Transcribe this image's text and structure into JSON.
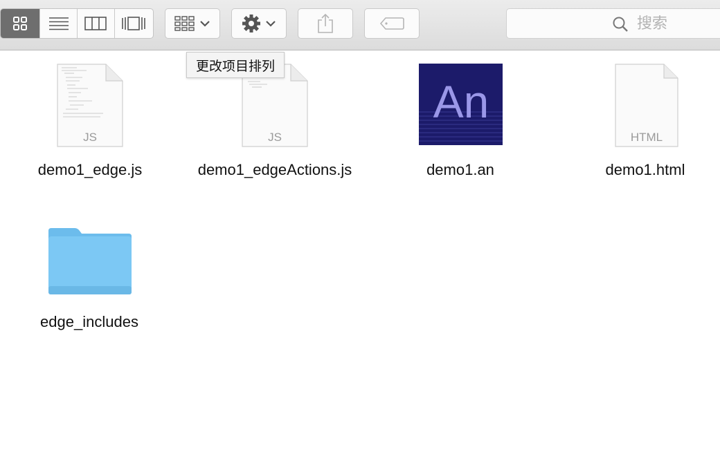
{
  "toolbar": {
    "view_modes": [
      {
        "id": "icon-view",
        "label": "Icons",
        "active": true
      },
      {
        "id": "list-view",
        "label": "List",
        "active": false
      },
      {
        "id": "column-view",
        "label": "Columns",
        "active": false
      },
      {
        "id": "coverflow-view",
        "label": "Cover Flow",
        "active": false
      }
    ],
    "arrange_icon": "arrange-grid-icon",
    "action_icon": "gear-icon",
    "share_icon": "share-icon",
    "tag_icon": "tag-icon",
    "search": {
      "placeholder": "搜索"
    }
  },
  "tooltip": {
    "text": "更改项目排列"
  },
  "files": [
    {
      "name": "demo1_edge.js",
      "type": "JS",
      "icon": "js-document-icon"
    },
    {
      "name": "demo1_edgeActions.js",
      "type": "JS",
      "icon": "js-document-icon"
    },
    {
      "name": "demo1.an",
      "type": "An",
      "icon": "animate-document-icon"
    },
    {
      "name": "demo1.html",
      "type": "HTML",
      "icon": "html-document-icon"
    },
    {
      "name": "edge_includes",
      "type": "folder",
      "icon": "folder-icon"
    }
  ],
  "colors": {
    "active_segment": "#6e6e6e",
    "folder": "#7cc8f4",
    "an_bg": "#1c1b6a",
    "an_text": "#9a97e8"
  }
}
